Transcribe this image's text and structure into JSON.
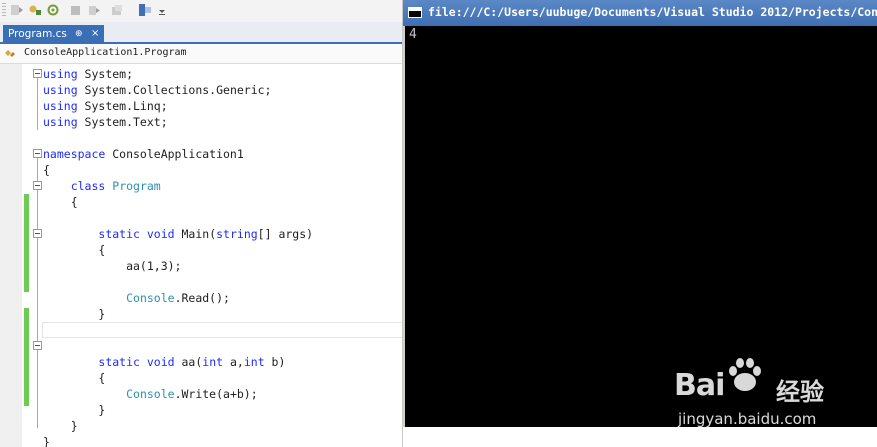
{
  "ide": {
    "tab": {
      "label": "Program.cs",
      "pin_glyph": "⊕",
      "close_glyph": "×"
    },
    "navbar": {
      "class_name": "ConsoleApplication1.Program"
    },
    "code_lines": [
      {
        "parts": [
          {
            "t": "using",
            "c": "kw"
          },
          {
            "t": " System;",
            "c": ""
          }
        ]
      },
      {
        "parts": [
          {
            "t": "using",
            "c": "kw"
          },
          {
            "t": " System.Collections.Generic;",
            "c": ""
          }
        ]
      },
      {
        "parts": [
          {
            "t": "using",
            "c": "kw"
          },
          {
            "t": " System.Linq;",
            "c": ""
          }
        ]
      },
      {
        "parts": [
          {
            "t": "using",
            "c": "kw"
          },
          {
            "t": " System.Text;",
            "c": ""
          }
        ]
      },
      {
        "parts": []
      },
      {
        "parts": [
          {
            "t": "namespace",
            "c": "kw"
          },
          {
            "t": " ConsoleApplication1",
            "c": ""
          }
        ]
      },
      {
        "parts": [
          {
            "t": "{",
            "c": ""
          }
        ]
      },
      {
        "parts": [
          {
            "t": "    ",
            "c": ""
          },
          {
            "t": "class",
            "c": "kw"
          },
          {
            "t": " ",
            "c": ""
          },
          {
            "t": "Program",
            "c": "tp"
          }
        ]
      },
      {
        "parts": [
          {
            "t": "    {",
            "c": ""
          }
        ]
      },
      {
        "parts": []
      },
      {
        "parts": [
          {
            "t": "        ",
            "c": ""
          },
          {
            "t": "static",
            "c": "kw"
          },
          {
            "t": " ",
            "c": ""
          },
          {
            "t": "void",
            "c": "kw"
          },
          {
            "t": " Main(",
            "c": ""
          },
          {
            "t": "string",
            "c": "kw"
          },
          {
            "t": "[] args)",
            "c": ""
          }
        ]
      },
      {
        "parts": [
          {
            "t": "        {",
            "c": ""
          }
        ]
      },
      {
        "parts": [
          {
            "t": "            aa(1,3);",
            "c": ""
          }
        ]
      },
      {
        "parts": []
      },
      {
        "parts": [
          {
            "t": "            ",
            "c": ""
          },
          {
            "t": "Console",
            "c": "tp"
          },
          {
            "t": ".Read();",
            "c": ""
          }
        ]
      },
      {
        "parts": [
          {
            "t": "        }",
            "c": ""
          }
        ]
      },
      {
        "parts": []
      },
      {
        "parts": []
      },
      {
        "parts": [
          {
            "t": "        ",
            "c": ""
          },
          {
            "t": "static",
            "c": "kw"
          },
          {
            "t": " ",
            "c": ""
          },
          {
            "t": "void",
            "c": "kw"
          },
          {
            "t": " aa(",
            "c": ""
          },
          {
            "t": "int",
            "c": "kw"
          },
          {
            "t": " a,",
            "c": ""
          },
          {
            "t": "int",
            "c": "kw"
          },
          {
            "t": " b)",
            "c": ""
          }
        ]
      },
      {
        "parts": [
          {
            "t": "        {",
            "c": ""
          }
        ]
      },
      {
        "parts": [
          {
            "t": "            ",
            "c": ""
          },
          {
            "t": "Console",
            "c": "tp"
          },
          {
            "t": ".Write(a+b);",
            "c": ""
          }
        ]
      },
      {
        "parts": [
          {
            "t": "        }",
            "c": ""
          }
        ]
      },
      {
        "parts": [
          {
            "t": "    }",
            "c": ""
          }
        ]
      },
      {
        "parts": [
          {
            "t": "}",
            "c": ""
          }
        ]
      }
    ]
  },
  "console": {
    "title": "file:///C:/Users/uubuge/Documents/Visual Studio 2012/Projects/Con",
    "output": "4"
  },
  "watermark": {
    "logo_text": "Bai",
    "cn_text": "经验",
    "url": "jingyan.baidu.com"
  },
  "colors": {
    "keyword": "#1d2bff",
    "type": "#2b91af",
    "tab_active": "#3a6fb6",
    "change_bar": "#6ccc53",
    "console_bg": "#000000"
  }
}
